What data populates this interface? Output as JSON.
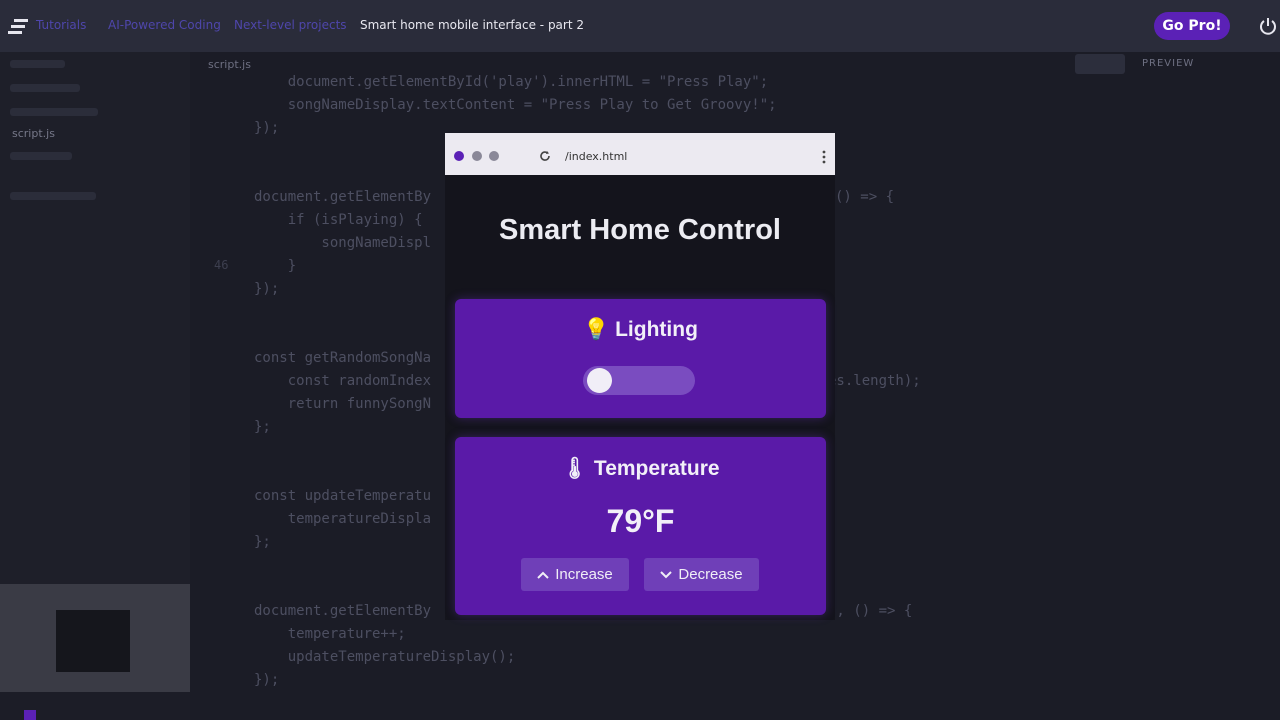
{
  "topbar": {
    "breadcrumbs": [
      "Tutorials",
      "AI-Powered Coding",
      "Next-level projects"
    ],
    "current": "Smart home mobile interface - part 2",
    "go_pro_label": "Go Pro!"
  },
  "editor": {
    "file_tab": "script.js",
    "sidebar_file": "script.js",
    "preview_label": "PREVIEW",
    "line_number_visible": "46",
    "code_lines": [
      "    document.getElementById('play').innerHTML = \"Press Play\";",
      "    songNameDisplay.textContent = \"Press Play to Get Groovy!\";",
      "});",
      "",
      "document.getElementBy",
      "    if (isPlaying) {",
      "        songNameDispl",
      "    }",
      "});",
      "",
      "const getRandomSongNa",
      "    const randomIndex",
      "    return funnySongN",
      "};",
      "",
      "const updateTemperatu",
      "    temperatureDispla",
      "};",
      "",
      "document.getElementBy",
      "    temperature++;",
      "    updateTemperatureDisplay();",
      "});"
    ],
    "code_right_fragments": [
      "() => {",
      "es.length);",
      "', () => {"
    ]
  },
  "browser": {
    "url": "/index.html"
  },
  "app": {
    "title": "Smart Home Control",
    "lighting": {
      "title": "Lighting",
      "toggle_on": false
    },
    "temperature": {
      "title": "Temperature",
      "value": "79°F",
      "increase_label": "Increase",
      "decrease_label": "Decrease"
    }
  },
  "colors": {
    "accent": "#5b21b6",
    "card": "#5a1aa8",
    "background": "#1c1d27"
  },
  "icons": [
    "menu-logo-icon",
    "power-icon",
    "reload-icon",
    "kebab-menu-icon",
    "lightbulb-icon",
    "thermometer-icon",
    "chevron-up-icon",
    "chevron-down-icon"
  ]
}
